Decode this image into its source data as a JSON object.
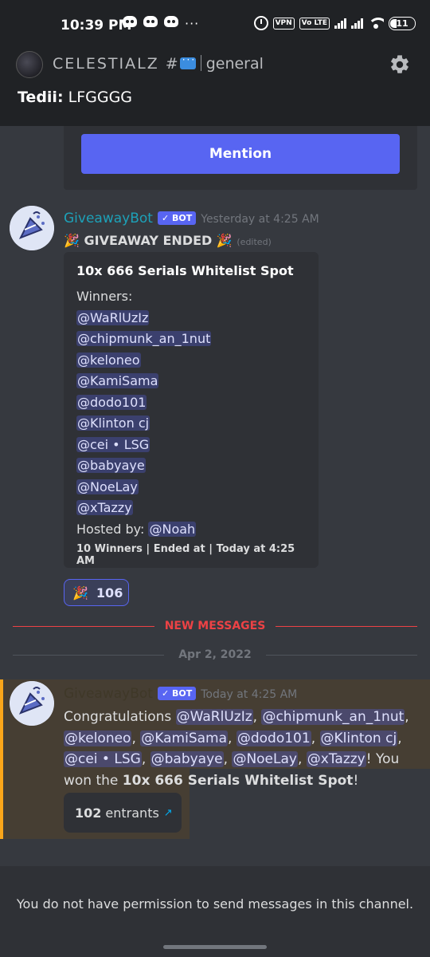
{
  "status_bar": {
    "time": "10:39 PM",
    "dots": "···",
    "vpn": "VPN",
    "volte": "Vo LTE",
    "battery": "11"
  },
  "header": {
    "server_name": "CELESTIALZ #",
    "channel": "general",
    "topic_author": "Tedii:",
    "topic_text": "LFGGGG"
  },
  "prev_embed": {
    "button_label": "Mention"
  },
  "message1": {
    "author": "GiveawayBot",
    "bot_badge": "✓ BOT",
    "time": "Yesterday at 4:25 AM",
    "content": "GIVEAWAY ENDED",
    "edited": "(edited)",
    "embed": {
      "title": "10x 666 Serials Whitelist Spot",
      "winners_label": "Winners:",
      "winners": [
        "@WaRlUzIz",
        "@chipmunk_an_1nut",
        "@keloneo",
        "@KamiSama",
        "@dodo101",
        "@Klinton cj",
        "@cei • LSG",
        "@babyaye",
        "@NoeLay",
        "@xTazzy"
      ],
      "hosted_label": "Hosted by:",
      "host": "@Noah",
      "footer": "10 Winners | Ended at | Today at 4:25 AM"
    },
    "reaction": {
      "emoji": "🎉",
      "count": "106"
    }
  },
  "dividers": {
    "new_messages": "NEW MESSAGES",
    "date": "Apr 2, 2022"
  },
  "message2": {
    "author": "GiveawayBot",
    "bot_badge": "✓ BOT",
    "time": "Today at 4:25 AM",
    "congrats": "Congratulations",
    "mentions": [
      "@WaRlUzIz",
      "@chipmunk_an_1nut",
      "@keloneo",
      "@KamiSama",
      "@dodo101",
      "@Klinton cj",
      "@cei • LSG",
      "@babyaye",
      "@NoeLay",
      "@xTazzy"
    ],
    "won_text": "! You won the",
    "prize": "10x 666 Serials Whitelist Spot",
    "end": "!",
    "entrants_count": "102",
    "entrants_label": "entrants",
    "arrow": "↗"
  },
  "composer": {
    "notice": "You do not have permission to send messages in this channel."
  },
  "colors": {
    "background": "#36393f",
    "blurple": "#5865f2",
    "highlight": "#463e33",
    "accent_red": "#ed4245"
  }
}
